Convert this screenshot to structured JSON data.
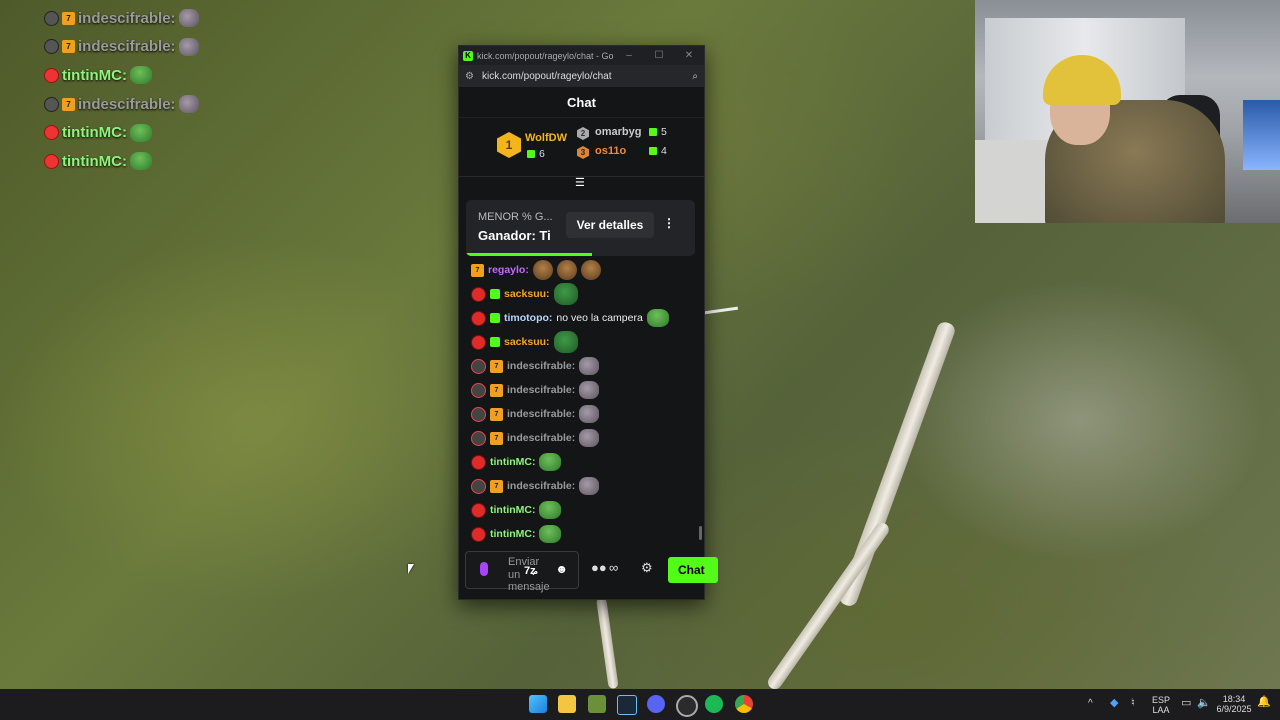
{
  "overlay": {
    "messages": [
      {
        "badge": "mod",
        "sub": true,
        "user": "indescifrable:",
        "color": "gray",
        "emote": "gorilla"
      },
      {
        "badge": "mod",
        "sub": true,
        "user": "indescifrable:",
        "color": "gray",
        "emote": "gorilla"
      },
      {
        "badge": "red",
        "sub": false,
        "user": "tintinMC:",
        "color": "green",
        "emote": "pepe"
      },
      {
        "badge": "mod",
        "sub": true,
        "user": "indescifrable:",
        "color": "gray",
        "emote": "gorilla"
      },
      {
        "badge": "red",
        "sub": false,
        "user": "tintinMC:",
        "color": "green",
        "emote": "pepe"
      },
      {
        "badge": "red",
        "sub": false,
        "user": "tintinMC:",
        "color": "green",
        "emote": "pepe"
      }
    ]
  },
  "window": {
    "title": "kick.com/popout/rageylo/chat - Goo...",
    "url": "kick.com/popout/rageylo/chat",
    "minimize": "–",
    "maximize": "☐",
    "close": "✕"
  },
  "chat": {
    "header": "Chat",
    "leaderboard": {
      "first": {
        "rank": "1",
        "name": "WolfDW",
        "count": "6"
      },
      "second": {
        "rank": "2",
        "name": "omarbyg",
        "count": "5"
      },
      "third": {
        "rank": "3",
        "name": "os11o",
        "count": "4"
      }
    },
    "prediction": {
      "question": "MENOR % G...",
      "winner_label": "Ganador:",
      "winner_value": "Ti",
      "details_button": "Ver detalles",
      "progress_fraction": 0.55
    },
    "messages": [
      {
        "badges": [
          "sub"
        ],
        "user": "regaylo:",
        "color": "#c36bff",
        "text": "",
        "emote": "monk3"
      },
      {
        "badges": [
          "red",
          "gift"
        ],
        "user": "sacksuu:",
        "color": "#f5a623",
        "text": "",
        "emote": "blob"
      },
      {
        "badges": [
          "red",
          "gift"
        ],
        "user": "timotopo:",
        "color": "#b7d7ff",
        "text": "no veo la campera",
        "emote": "pepe"
      },
      {
        "badges": [
          "red",
          "gift"
        ],
        "user": "sacksuu:",
        "color": "#f5a623",
        "text": "",
        "emote": "blob"
      },
      {
        "badges": [
          "mod",
          "sub"
        ],
        "user": "indescifrable:",
        "color": "#9a9a9a",
        "text": "",
        "emote": "gorilla"
      },
      {
        "badges": [
          "mod",
          "sub"
        ],
        "user": "indescifrable:",
        "color": "#9a9a9a",
        "text": "",
        "emote": "gorilla"
      },
      {
        "badges": [
          "mod",
          "sub"
        ],
        "user": "indescifrable:",
        "color": "#9a9a9a",
        "text": "",
        "emote": "gorilla"
      },
      {
        "badges": [
          "mod",
          "sub"
        ],
        "user": "indescifrable:",
        "color": "#9a9a9a",
        "text": "",
        "emote": "gorilla"
      },
      {
        "badges": [
          "red"
        ],
        "user": "tintinMC:",
        "color": "#8df57a",
        "text": "",
        "emote": "pepe"
      },
      {
        "badges": [
          "mod",
          "sub"
        ],
        "user": "indescifrable:",
        "color": "#9a9a9a",
        "text": "",
        "emote": "gorilla"
      },
      {
        "badges": [
          "red"
        ],
        "user": "tintinMC:",
        "color": "#8df57a",
        "text": "",
        "emote": "pepe"
      },
      {
        "badges": [
          "red"
        ],
        "user": "tintinMC:",
        "color": "#8df57a",
        "text": "",
        "emote": "pepe"
      }
    ],
    "composer_placeholder": "Enviar un mensaje",
    "send_button": "Chat"
  },
  "taskbar": {
    "icons": [
      "windows-start-icon",
      "file-explorer-icon",
      "minecraft-icon",
      "steam-icon",
      "discord-icon",
      "obs-icon",
      "spotify-icon",
      "chrome-icon"
    ],
    "language": "ESP",
    "layout": "LAA",
    "time": "18:34",
    "date": "6/9/2025"
  },
  "colors": {
    "kick_green": "#53fc18",
    "chat_bg": "#141517"
  }
}
